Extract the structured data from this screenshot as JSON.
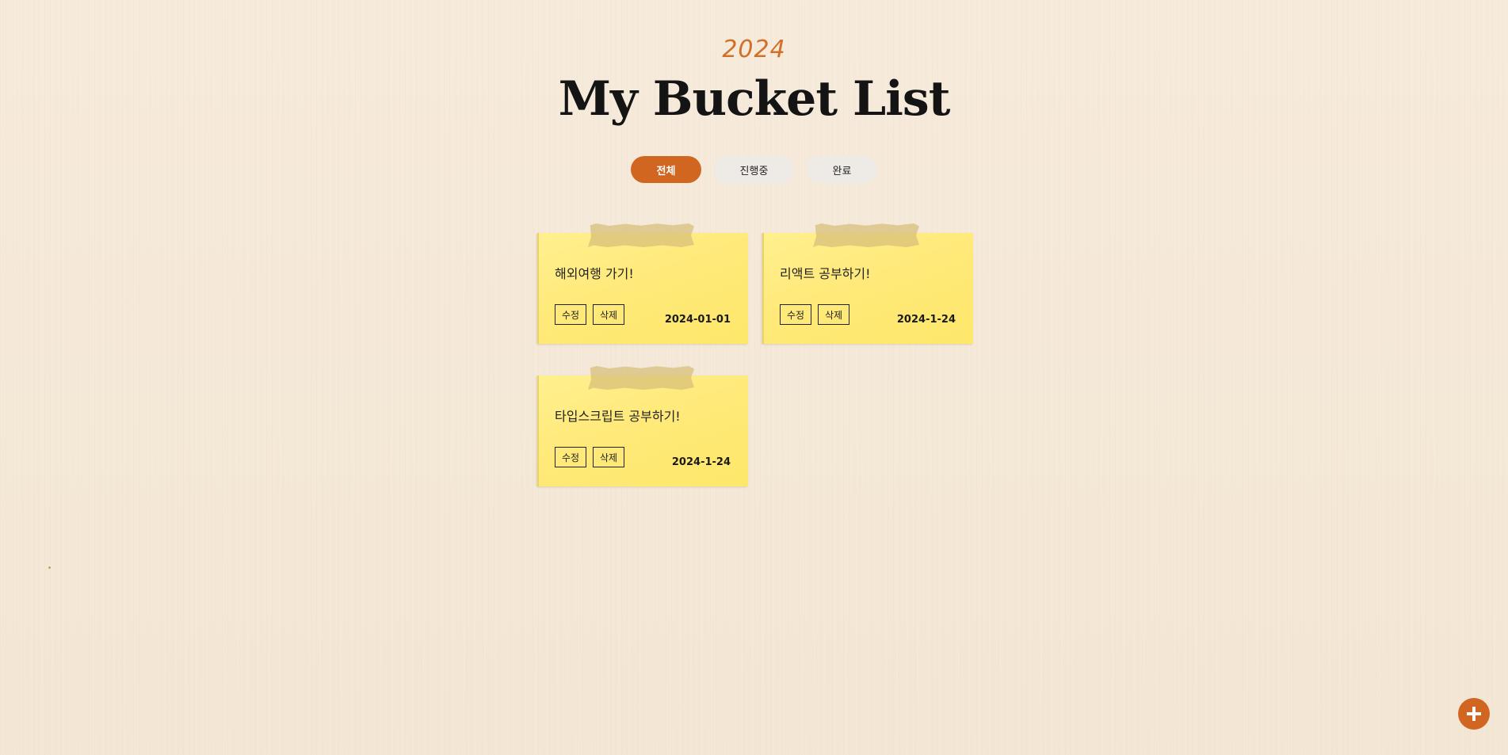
{
  "header": {
    "year": "2024",
    "title": "My Bucket List"
  },
  "filters": [
    {
      "label": "전체",
      "active": true
    },
    {
      "label": "진행중",
      "active": false
    },
    {
      "label": "완료",
      "active": false
    }
  ],
  "cards": [
    {
      "text": "해외여행 가기!",
      "edit_label": "수정",
      "delete_label": "삭제",
      "date": "2024-01-01"
    },
    {
      "text": "리액트 공부하기!",
      "edit_label": "수정",
      "delete_label": "삭제",
      "date": "2024-1-24"
    },
    {
      "text": "타입스크립트 공부하기!",
      "edit_label": "수정",
      "delete_label": "삭제",
      "date": "2024-1-24"
    }
  ],
  "add_button": {
    "icon": "plus-icon"
  },
  "colors": {
    "accent": "#d06620",
    "background": "#f5e9d8",
    "note": "#ffed80",
    "year": "#d0702a"
  }
}
